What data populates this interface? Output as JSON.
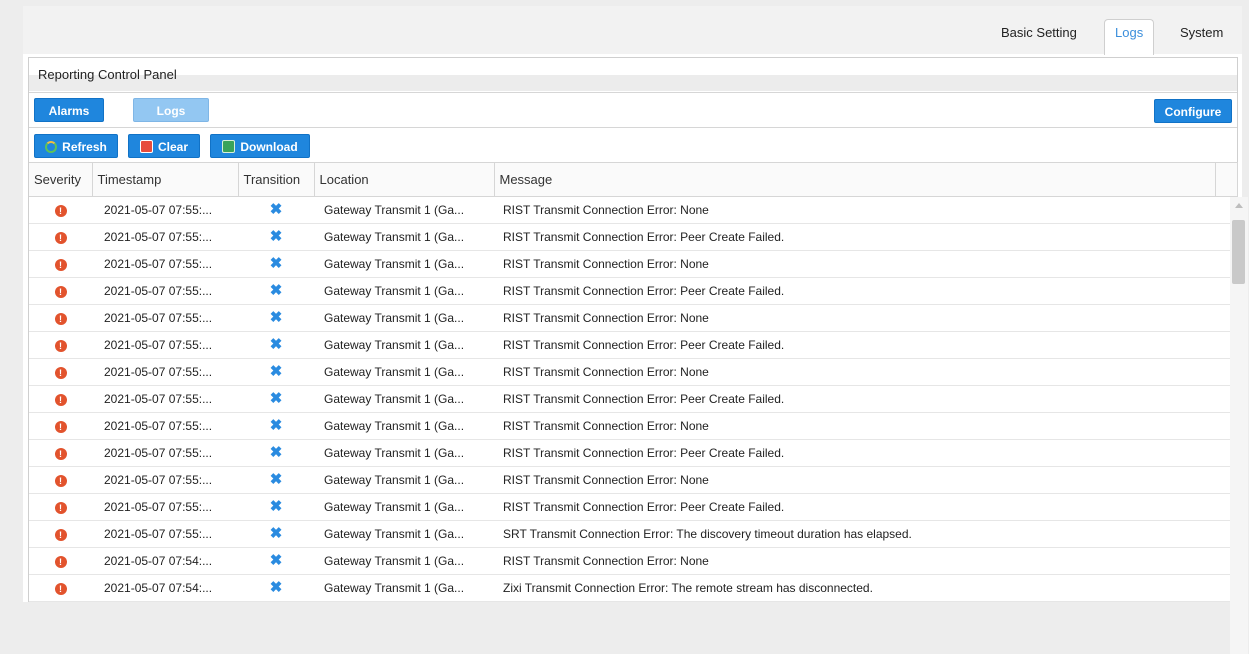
{
  "tabs": [
    "Basic Setting",
    "Logs",
    "System"
  ],
  "active_tab": "Logs",
  "panel": {
    "title": "Reporting Control Panel"
  },
  "view_buttons": {
    "alarms": "Alarms",
    "logs": "Logs",
    "configure": "Configure"
  },
  "toolbar": {
    "refresh": "Refresh",
    "clear": "Clear",
    "download": "Download"
  },
  "columns": [
    "Severity",
    "Timestamp",
    "Transition",
    "Location",
    "Message"
  ],
  "rows": [
    {
      "timestamp": "2021-05-07 07:55:...",
      "location": "Gateway Transmit 1 (Ga...",
      "message": "RIST Transmit Connection Error: None"
    },
    {
      "timestamp": "2021-05-07 07:55:...",
      "location": "Gateway Transmit 1 (Ga...",
      "message": "RIST Transmit Connection Error: Peer Create Failed."
    },
    {
      "timestamp": "2021-05-07 07:55:...",
      "location": "Gateway Transmit 1 (Ga...",
      "message": "RIST Transmit Connection Error: None"
    },
    {
      "timestamp": "2021-05-07 07:55:...",
      "location": "Gateway Transmit 1 (Ga...",
      "message": "RIST Transmit Connection Error: Peer Create Failed."
    },
    {
      "timestamp": "2021-05-07 07:55:...",
      "location": "Gateway Transmit 1 (Ga...",
      "message": "RIST Transmit Connection Error: None"
    },
    {
      "timestamp": "2021-05-07 07:55:...",
      "location": "Gateway Transmit 1 (Ga...",
      "message": "RIST Transmit Connection Error: Peer Create Failed."
    },
    {
      "timestamp": "2021-05-07 07:55:...",
      "location": "Gateway Transmit 1 (Ga...",
      "message": "RIST Transmit Connection Error: None"
    },
    {
      "timestamp": "2021-05-07 07:55:...",
      "location": "Gateway Transmit 1 (Ga...",
      "message": "RIST Transmit Connection Error: Peer Create Failed."
    },
    {
      "timestamp": "2021-05-07 07:55:...",
      "location": "Gateway Transmit 1 (Ga...",
      "message": "RIST Transmit Connection Error: None"
    },
    {
      "timestamp": "2021-05-07 07:55:...",
      "location": "Gateway Transmit 1 (Ga...",
      "message": "RIST Transmit Connection Error: Peer Create Failed."
    },
    {
      "timestamp": "2021-05-07 07:55:...",
      "location": "Gateway Transmit 1 (Ga...",
      "message": "RIST Transmit Connection Error: None"
    },
    {
      "timestamp": "2021-05-07 07:55:...",
      "location": "Gateway Transmit 1 (Ga...",
      "message": "RIST Transmit Connection Error: Peer Create Failed."
    },
    {
      "timestamp": "2021-05-07 07:55:...",
      "location": "Gateway Transmit 1 (Ga...",
      "message": "SRT Transmit Connection Error: The discovery timeout duration has elapsed."
    },
    {
      "timestamp": "2021-05-07 07:54:...",
      "location": "Gateway Transmit 1 (Ga...",
      "message": "RIST Transmit Connection Error: None"
    },
    {
      "timestamp": "2021-05-07 07:54:...",
      "location": "Gateway Transmit 1 (Ga...",
      "message": "Zixi Transmit Connection Error: The remote stream has disconnected."
    }
  ],
  "icons": {
    "severity": "error-icon",
    "transition": "x-mark-icon",
    "refresh": "refresh-icon",
    "clear": "clear-icon",
    "download": "download-icon"
  },
  "colors": {
    "accent": "#1f86dd",
    "error": "#e2532d",
    "active_tab_text": "#3b8edb"
  }
}
